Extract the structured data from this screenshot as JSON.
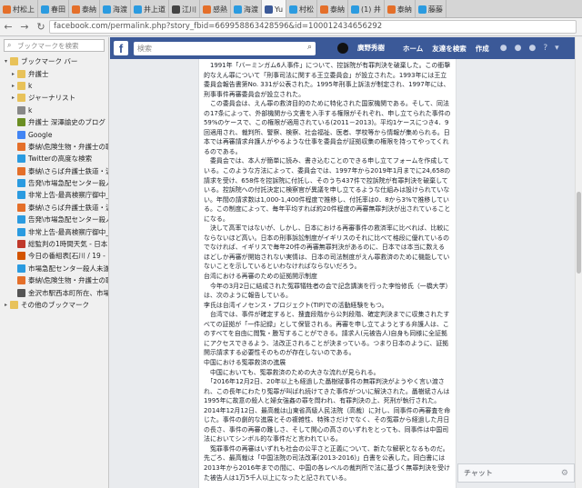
{
  "tabs": [
    {
      "label": "村松上",
      "color": "#e46f2a"
    },
    {
      "label": "春田",
      "color": "#2b9be0"
    },
    {
      "label": "泰納",
      "color": "#e46f2a"
    },
    {
      "label": "海渡",
      "color": "#2b9be0"
    },
    {
      "label": "井上道",
      "color": "#2b9be0"
    },
    {
      "label": "江川",
      "color": "#444"
    },
    {
      "label": "感熱",
      "color": "#e46f2a"
    },
    {
      "label": "海渡",
      "color": "#2b9be0"
    },
    {
      "label": "Yu",
      "color": "#3b5998",
      "active": true
    },
    {
      "label": "村松",
      "color": "#2b9be0"
    },
    {
      "label": "泰納",
      "color": "#e46f2a"
    },
    {
      "label": "(1) 井",
      "color": "#2b9be0"
    },
    {
      "label": "泰納",
      "color": "#e46f2a"
    },
    {
      "label": "藤藤",
      "color": "#2b9be0"
    }
  ],
  "url": "facebook.com/permalink.php?story_fbid=669958863428596&id=100012434656292",
  "sidebar": {
    "search_placeholder": "ブックマークを検索",
    "items": [
      {
        "label": "ブックマーク バー",
        "type": "folder",
        "indent": 0,
        "twisty": "▾"
      },
      {
        "label": "弁護士",
        "type": "folder",
        "indent": 1,
        "twisty": "▸"
      },
      {
        "label": "k",
        "type": "folder",
        "indent": 1,
        "twisty": "▸"
      },
      {
        "label": "ジャーナリスト",
        "type": "folder",
        "indent": 1,
        "twisty": "▸"
      },
      {
        "label": "k",
        "type": "page",
        "indent": 1,
        "color": "#888"
      },
      {
        "label": "弁護士 深澤諭史のブログ",
        "type": "page",
        "indent": 1,
        "color": "#6b8e23"
      },
      {
        "label": "Google",
        "type": "page",
        "indent": 1,
        "color": "#4285f4"
      },
      {
        "label": "泰納\\危険生物・弁護士の職",
        "type": "page",
        "indent": 1,
        "color": "#e46f2a"
      },
      {
        "label": "Twitterの高度な検索",
        "type": "page",
        "indent": 1,
        "color": "#2b9be0"
      },
      {
        "label": "泰納\\さらば弁護士鉄道・泥",
        "type": "page",
        "indent": 1,
        "color": "#e46f2a"
      },
      {
        "label": "告発\\市場急配センター殺人",
        "type": "page",
        "indent": 1,
        "color": "#2b9be0"
      },
      {
        "label": "非常上告-最高検察庁御中_",
        "type": "page",
        "indent": 1,
        "color": "#2b9be0"
      },
      {
        "label": "泰納\\さらば弁護士鉄道・泥",
        "type": "page",
        "indent": 1,
        "color": "#e46f2a"
      },
      {
        "label": "告発\\市場急配センター殺人",
        "type": "page",
        "indent": 1,
        "color": "#2b9be0"
      },
      {
        "label": "非常上告-最高検察庁御中_",
        "type": "page",
        "indent": 1,
        "color": "#2b9be0"
      },
      {
        "label": "総監判の1時間天気 - 日本",
        "type": "page",
        "indent": 1,
        "color": "#c0392b"
      },
      {
        "label": "今日の番組表[石川 / 19 -",
        "type": "page",
        "indent": 1,
        "color": "#d35400"
      },
      {
        "label": "市場急配センター殺人未遂",
        "type": "page",
        "indent": 1,
        "color": "#2b9be0"
      },
      {
        "label": "泰納\\危険生物・弁護士の職",
        "type": "page",
        "indent": 1,
        "color": "#e46f2a"
      },
      {
        "label": "金沢市駅西本町所在、市場",
        "type": "page",
        "indent": 1,
        "color": "#555"
      },
      {
        "label": "その他のブックマーク",
        "type": "folder",
        "indent": 0,
        "twisty": "▸"
      }
    ]
  },
  "fb": {
    "search_placeholder": "検索",
    "user": "廣野秀樹",
    "nav": [
      "ホーム",
      "友達を検索",
      "作成"
    ]
  },
  "paragraphs": [
    "　1991年「バーミンガム6人事件」について、控訴院が有罪判決を破棄した。この衝撃的なえん罪について「刑事司法に関する王立委員会」が設立された。1993年には王立委員会報告書第No. 331が公表された。1995年刑事上訴法が制定され、1997年には、刑事事件再審委員会が設立された。",
    "　この委員会は、えん罪の救済目的のために特化された国家機関である。そして、同法の17条によって、外部機関から文書を入手する権限がそれぞれ、申し立てられた事件の59%のケースで、この権限が適用されている(2011－2013)。平均1ケースにつき4．9回適用され、裁判所、警察、検察、社会福祉、医者、学校等から情報が集められる。日本では再審請求弁護人がやるような仕事を委員会が証拠収集の権限を持ってやってくれるのである。",
    "　委員会では、本人が簡単に読み、書き込むことのできる申し立てフォームを作成している。このような方法によって、委員会では、1997年から2019年1月までに24,658の請求を受け、658件を控訴院に付託し、そのうち437件で控訴院が有罪判決を破棄している。控訴院への付託決定に検察官が異議を申し立てるような仕組みは設けられていない。年間の請求数は1,000-1,400件程度で推移し、付託率は0．8から3%で推移している。この制度によって、毎年平均すれば約20件程度の再審無罪判決が出されていることになる。",
    "　決して高率ではないが、しかし、日本における再審事件の救済率に比べれば、比較にならないほど高い。日本の刑事訴訟制度がイギリスのそれに比べて格段に優れているのでなければ、イギリスで毎年20件の再審無罪判決があるのに、日本では本当に数えるほどしか再審が開始されない実情は、日本の司法制度がえん罪救済のために機能していないことを示しているといわなければならないだろう。",
    "台湾における再審のための証拠開示制度",
    "　今年の3月2日に結成された冤罪犠牲者の会で記念講演を行った李怡修氏（一橋大学）は、次のように報告している。",
    "李氏は台湾イノセンス・プロジェクト(TIP)での活動経験をもつ。",
    "　台湾では、事件が確定すると、捜査段階から公判段階、確定判決までに収集されたすべての証拠が「一件記録」として保管される。再審を申し立てようとする弁護人は、このすべてを自由に閲覧・謄写することができる。請求人(元被告人)自身も同様に全証拠にアクセスできるよう、法改正されることが決まっている。つまり日本のように、証拠開示請求する必要性そのものが存在しないのである。",
    "中国における冤罪救済の進展",
    "　中国においても、冤罪救済のための大きな流れが見られる。",
    "　「2016年12月2日、20年以上も経過した聶樹斌事件の無罪判決がようやく言い渡され、この長年にわたり冤罪が叫ばれ続けてきた事件がついに解決された。聶樹斌さんは1995年に故意の殺人と婦女強姦の罪を問われ、有罪判決の上、死刑が執行された。2014年12月12日、最高裁は山東省高級人民法院（高裁）に対し、同事件の再審査を命じた。事件の劇的な進展とその複雑性、特殊さだけでなく、その冤罪から経過した月日の長さ、事件の再審の難しさ、そして関心の高さのいずれをとっても、同事件は中国司法においてシンボル的な事件だと言われている。",
    "　冤罪事件の再審はいずれも社会の公平さと正義について、新たな解釈となるものだ。先ごろ、最高裁は「中国法院の司法改革(2013-2016)」白書を公表した。同白書には2013年から2016年までの間に、中国の各レベルの裁判所で法に基づく無罪判決を受けた被告人は1万5千人以上になったと記されている。"
  ],
  "chat": {
    "label": "チャット"
  }
}
